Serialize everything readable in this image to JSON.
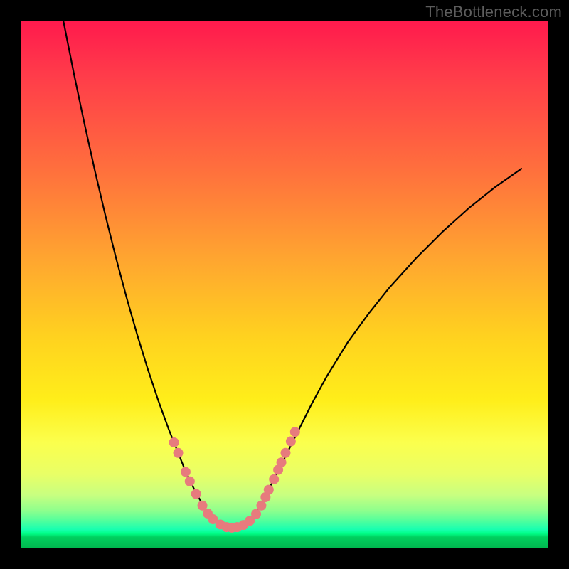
{
  "watermark": "TheBottleneck.com",
  "colors": {
    "frame": "#000000",
    "curve": "#000000",
    "dots": "#e77b7d",
    "gradient_stops": [
      "#ff1a4d",
      "#ff6f3d",
      "#ffd21f",
      "#fbff4d",
      "#8dff8d",
      "#00ff88",
      "#00b84f"
    ]
  },
  "chart_data": {
    "type": "line",
    "title": "",
    "xlabel": "",
    "ylabel": "",
    "xlim": [
      0,
      100
    ],
    "ylim": [
      0,
      100
    ],
    "grid": false,
    "legend": false,
    "series": [
      {
        "name": "left-branch",
        "x": [
          8,
          10,
          12,
          14,
          16,
          18,
          20,
          22,
          24,
          26,
          28,
          30,
          31,
          32,
          33,
          34,
          35,
          36,
          37
        ],
        "y": [
          100,
          90,
          80.5,
          71.5,
          63,
          55,
          47.5,
          40.5,
          34,
          28,
          22.5,
          17.5,
          15,
          12.8,
          10.8,
          9,
          7.4,
          6,
          4.8
        ]
      },
      {
        "name": "right-branch",
        "x": [
          43,
          44,
          45,
          46,
          48,
          50,
          52,
          55,
          58,
          62,
          66,
          70,
          75,
          80,
          85,
          90,
          95
        ],
        "y": [
          4.8,
          6,
          7.5,
          9.2,
          13,
          17,
          21,
          27,
          32.5,
          39,
          44.5,
          49.5,
          55,
          60,
          64.5,
          68.5,
          72
        ]
      },
      {
        "name": "valley-floor",
        "x": [
          37,
          38,
          39,
          40,
          41,
          42,
          43
        ],
        "y": [
          4.8,
          4.2,
          3.9,
          3.8,
          3.9,
          4.2,
          4.8
        ]
      }
    ],
    "scatter_overlay": {
      "name": "highlight-dots",
      "points": [
        {
          "x": 29.0,
          "y": 20.0
        },
        {
          "x": 29.8,
          "y": 18.0
        },
        {
          "x": 31.2,
          "y": 14.4
        },
        {
          "x": 32.0,
          "y": 12.6
        },
        {
          "x": 33.2,
          "y": 10.2
        },
        {
          "x": 34.4,
          "y": 8.0
        },
        {
          "x": 35.4,
          "y": 6.5
        },
        {
          "x": 36.4,
          "y": 5.4
        },
        {
          "x": 37.8,
          "y": 4.4
        },
        {
          "x": 39.0,
          "y": 3.9
        },
        {
          "x": 40.0,
          "y": 3.8
        },
        {
          "x": 41.0,
          "y": 3.9
        },
        {
          "x": 42.2,
          "y": 4.3
        },
        {
          "x": 43.4,
          "y": 5.1
        },
        {
          "x": 44.6,
          "y": 6.4
        },
        {
          "x": 45.6,
          "y": 8.0
        },
        {
          "x": 46.4,
          "y": 9.6
        },
        {
          "x": 47.0,
          "y": 11.0
        },
        {
          "x": 48.0,
          "y": 13.0
        },
        {
          "x": 48.8,
          "y": 14.8
        },
        {
          "x": 49.4,
          "y": 16.2
        },
        {
          "x": 50.2,
          "y": 18.0
        },
        {
          "x": 51.2,
          "y": 20.2
        },
        {
          "x": 52.0,
          "y": 22.0
        }
      ]
    }
  }
}
